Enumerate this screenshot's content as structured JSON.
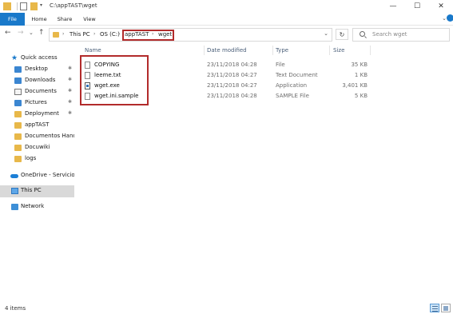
{
  "window": {
    "title": "C:\\appTAST\\wget",
    "minimize": "—",
    "maximize": "☐",
    "close": "✕"
  },
  "ribbon": {
    "tabs": [
      "File",
      "Home",
      "Share",
      "View"
    ]
  },
  "address": {
    "crumbs": [
      "This PC",
      "OS (C:)",
      "appTAST",
      "wget"
    ],
    "dropdown": "⌄",
    "refresh": "↻",
    "search_placeholder": "Search wget"
  },
  "nav_buttons": {
    "back": "←",
    "forward": "→",
    "recent": "⌄",
    "up": "↑"
  },
  "sidebar": {
    "quick_access": "Quick access",
    "items": [
      {
        "label": "Desktop",
        "pinned": true
      },
      {
        "label": "Downloads",
        "pinned": true
      },
      {
        "label": "Documents",
        "pinned": true
      },
      {
        "label": "Pictures",
        "pinned": true
      },
      {
        "label": "Deployment",
        "pinned": true
      },
      {
        "label": "appTAST",
        "pinned": false
      },
      {
        "label": "Documentos Handc",
        "pinned": false
      },
      {
        "label": "Docuwiki",
        "pinned": false
      },
      {
        "label": "logs",
        "pinned": false
      }
    ],
    "onedrive": "OneDrive - Servicios c",
    "this_pc": "This PC",
    "network": "Network",
    "pin_glyph": "✱"
  },
  "columns": {
    "name": "Name",
    "date": "Date modified",
    "type": "Type",
    "size": "Size"
  },
  "files": [
    {
      "name": "COPYING",
      "date": "23/11/2018 04:28",
      "type": "File",
      "size": "35 KB"
    },
    {
      "name": "leeme.txt",
      "date": "23/11/2018 04:27",
      "type": "Text Document",
      "size": "1 KB"
    },
    {
      "name": "wget.exe",
      "date": "23/11/2018 04:27",
      "type": "Application",
      "size": "3,401 KB"
    },
    {
      "name": "wget.ini.sample",
      "date": "23/11/2018 04:28",
      "type": "SAMPLE File",
      "size": "5 KB"
    }
  ],
  "status": {
    "item_count": "4 items"
  },
  "colors": {
    "accent": "#1979ca",
    "highlight_box": "#b22b2b",
    "folder": "#e8b84a"
  }
}
